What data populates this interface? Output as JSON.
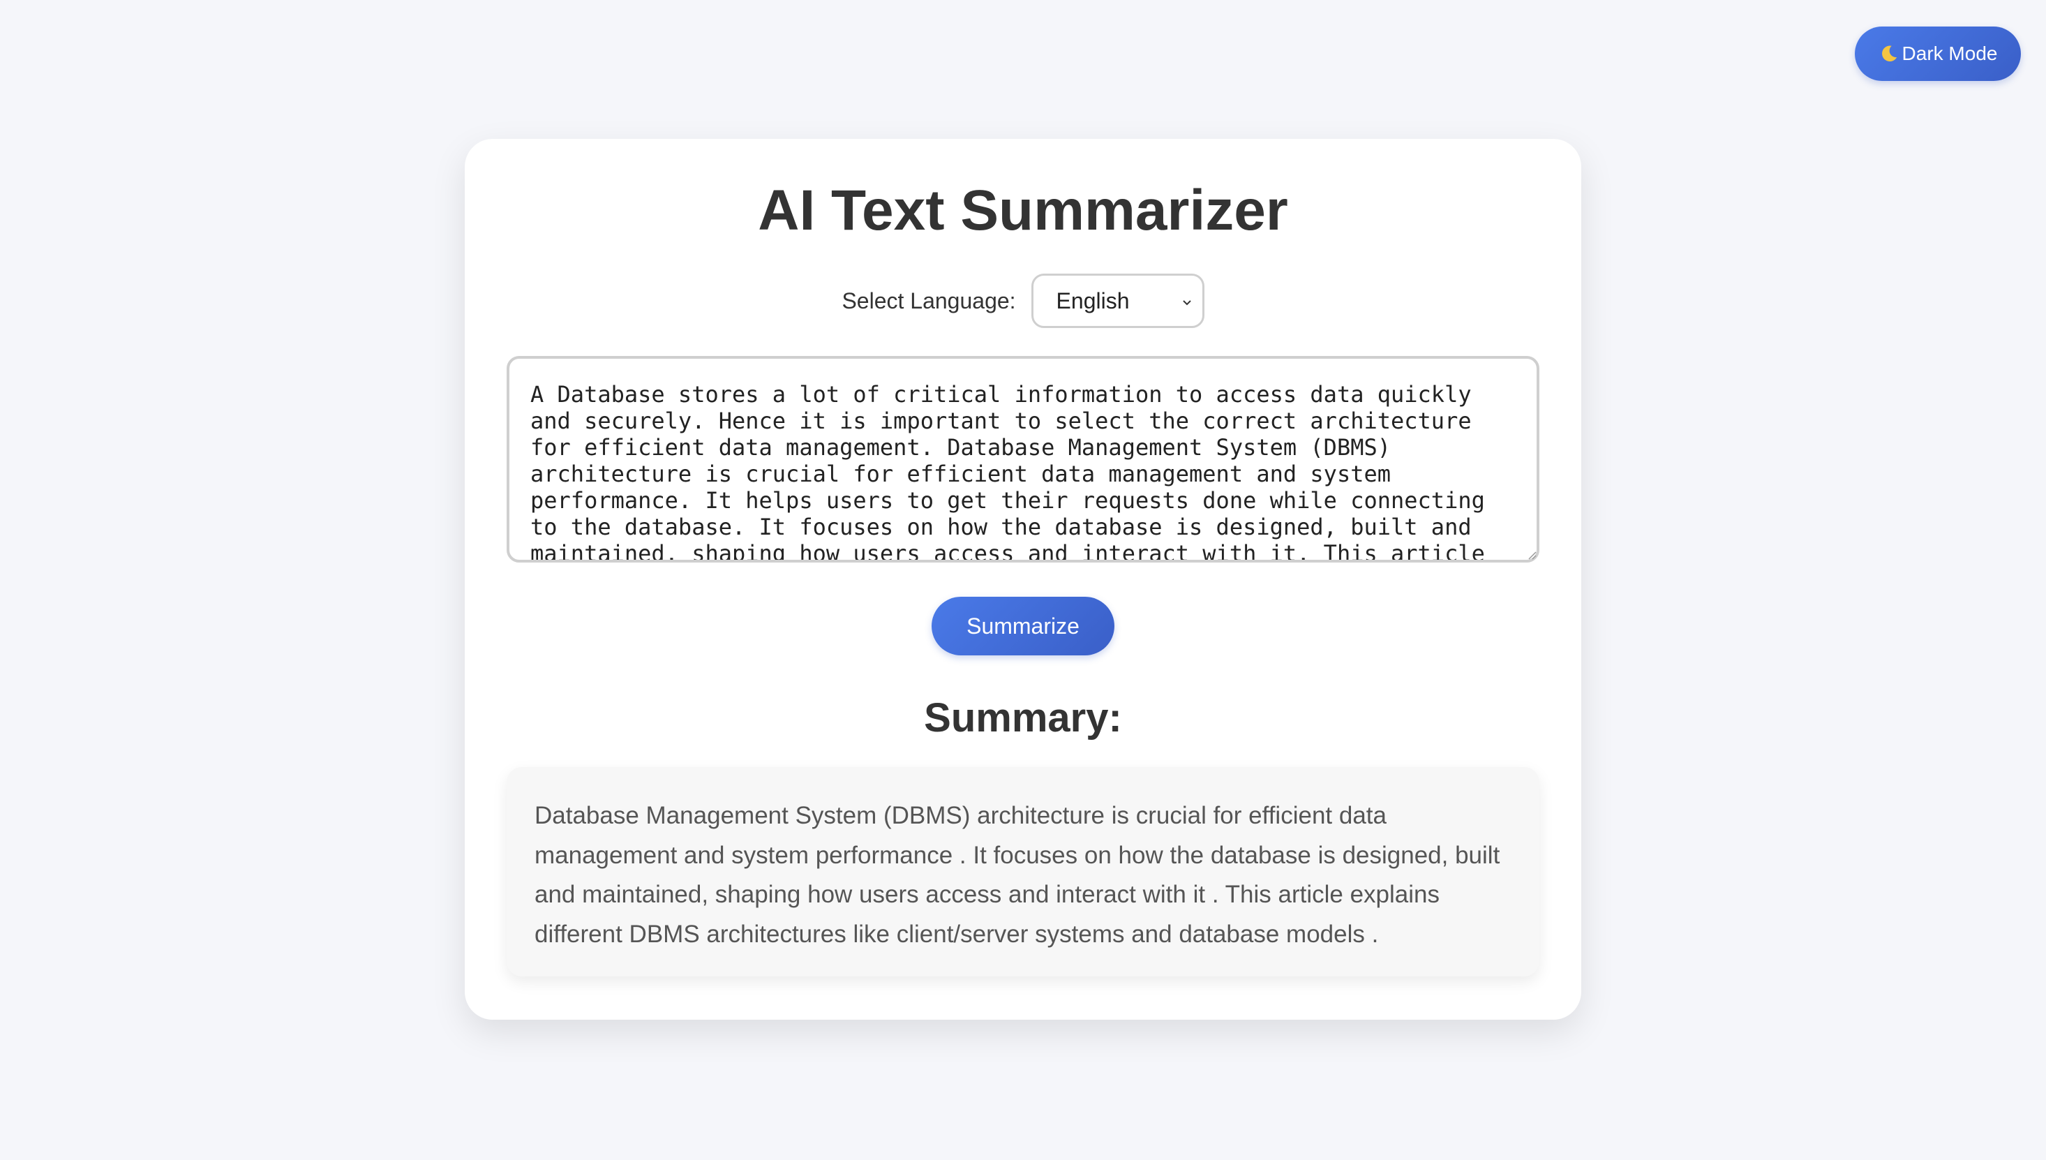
{
  "theme_toggle": {
    "label": "Dark Mode",
    "icon": "moon-icon"
  },
  "app": {
    "title": "AI Text Summarizer"
  },
  "language": {
    "label": "Select Language:",
    "selected": "English"
  },
  "input": {
    "text": "A Database stores a lot of critical information to access data quickly and securely. Hence it is important to select the correct architecture for efficient data management. Database Management System (DBMS) architecture is crucial for efficient data management and system performance. It helps users to get their requests done while connecting to the database. It focuses on how the database is designed, built and maintained, shaping how users access and interact with it. This article"
  },
  "actions": {
    "summarize_label": "Summarize"
  },
  "summary": {
    "heading": "Summary:",
    "text": "Database Management System (DBMS) architecture is crucial for efficient data management and system performance . It focuses on how the database is designed, built and maintained, shaping how users access and interact with it . This article explains different DBMS architectures like client/server systems and database models ."
  },
  "colors": {
    "accent": "#4a7ae8",
    "accent_dark": "#3a5fc8",
    "page_background": "#f5f6fa",
    "card_background": "#ffffff",
    "summary_background": "#f7f7f7",
    "text": "#333333"
  }
}
